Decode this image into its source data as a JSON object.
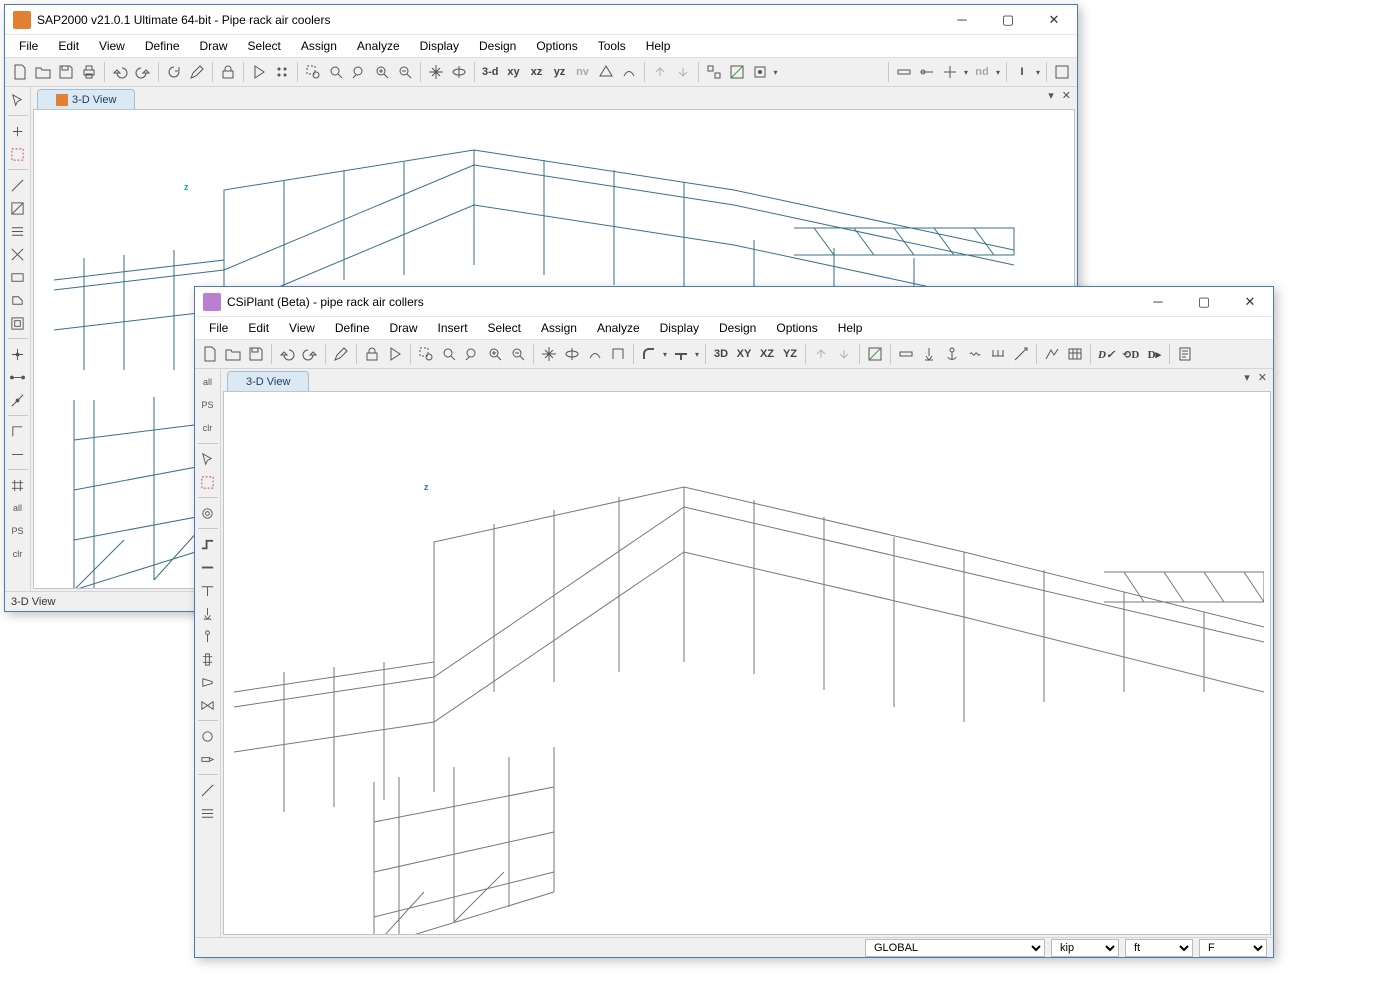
{
  "sap": {
    "title": "SAP2000 v21.0.1 Ultimate 64-bit - Pipe rack air coolers",
    "menus": [
      "File",
      "Edit",
      "View",
      "Define",
      "Draw",
      "Select",
      "Assign",
      "Analyze",
      "Display",
      "Design",
      "Options",
      "Tools",
      "Help"
    ],
    "tab": "3-D View",
    "status": "3-D View",
    "view_btns": {
      "v3d": "3-d",
      "xy": "xy",
      "xz": "xz",
      "yz": "yz",
      "nv": "nv",
      "nd": "nd",
      "I": "I"
    },
    "side_labels": {
      "all": "all",
      "ps": "PS",
      "clr": "clr"
    }
  },
  "plant": {
    "title": "CSiPlant (Beta) - pipe rack air collers",
    "menus": [
      "File",
      "Edit",
      "View",
      "Define",
      "Draw",
      "Insert",
      "Select",
      "Assign",
      "Analyze",
      "Display",
      "Design",
      "Options",
      "Help"
    ],
    "tab": "3-D View",
    "view_btns": {
      "v3d": "3D",
      "xy": "XY",
      "xz": "XZ",
      "yz": "YZ"
    },
    "status": {
      "coord": "GLOBAL",
      "force": "kip",
      "length": "ft",
      "temp": "F"
    },
    "side_labels": {
      "all": "all",
      "ps": "PS",
      "clr": "clr"
    }
  },
  "axis_label": "z"
}
